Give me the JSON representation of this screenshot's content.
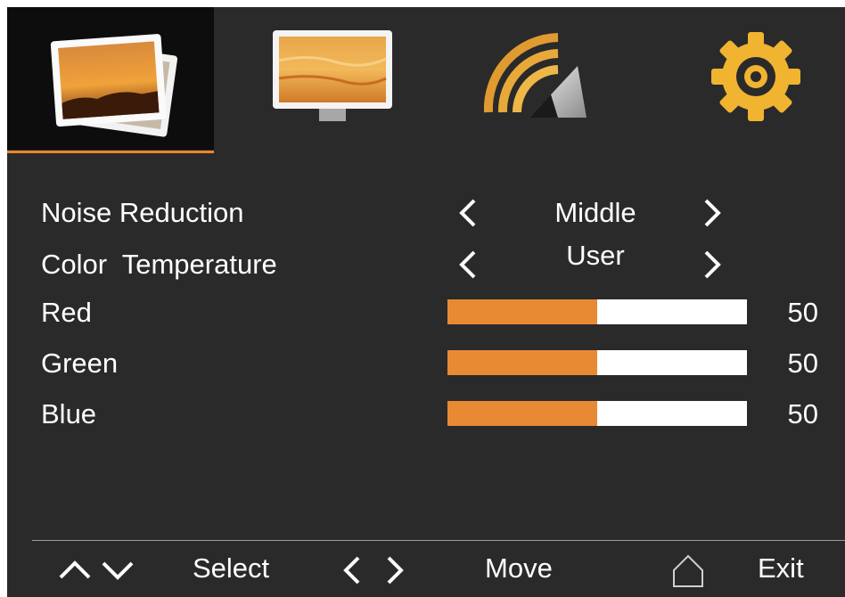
{
  "tabs": [
    {
      "name": "picture",
      "icon": "picture-photos-icon",
      "active": true
    },
    {
      "name": "display",
      "icon": "monitor-icon",
      "active": false
    },
    {
      "name": "signal",
      "icon": "wireless-signal-icon",
      "active": false
    },
    {
      "name": "setup",
      "icon": "gear-icon",
      "active": false
    }
  ],
  "accent_color": "#e8862a",
  "background_color": "#2a2a2a",
  "settings": {
    "noise_reduction": {
      "label": "Noise Reduction",
      "value": "Middle"
    },
    "color_temperature": {
      "label": "Color  Temperature",
      "value": "User"
    },
    "red": {
      "label": "Red",
      "value": "50",
      "level": 0.5
    },
    "green": {
      "label": "Green",
      "value": "50",
      "level": 0.5
    },
    "blue": {
      "label": "Blue",
      "value": "50",
      "level": 0.5
    }
  },
  "help_bar": {
    "select_label": "Select",
    "move_label": "Move",
    "exit_label": "Exit"
  }
}
